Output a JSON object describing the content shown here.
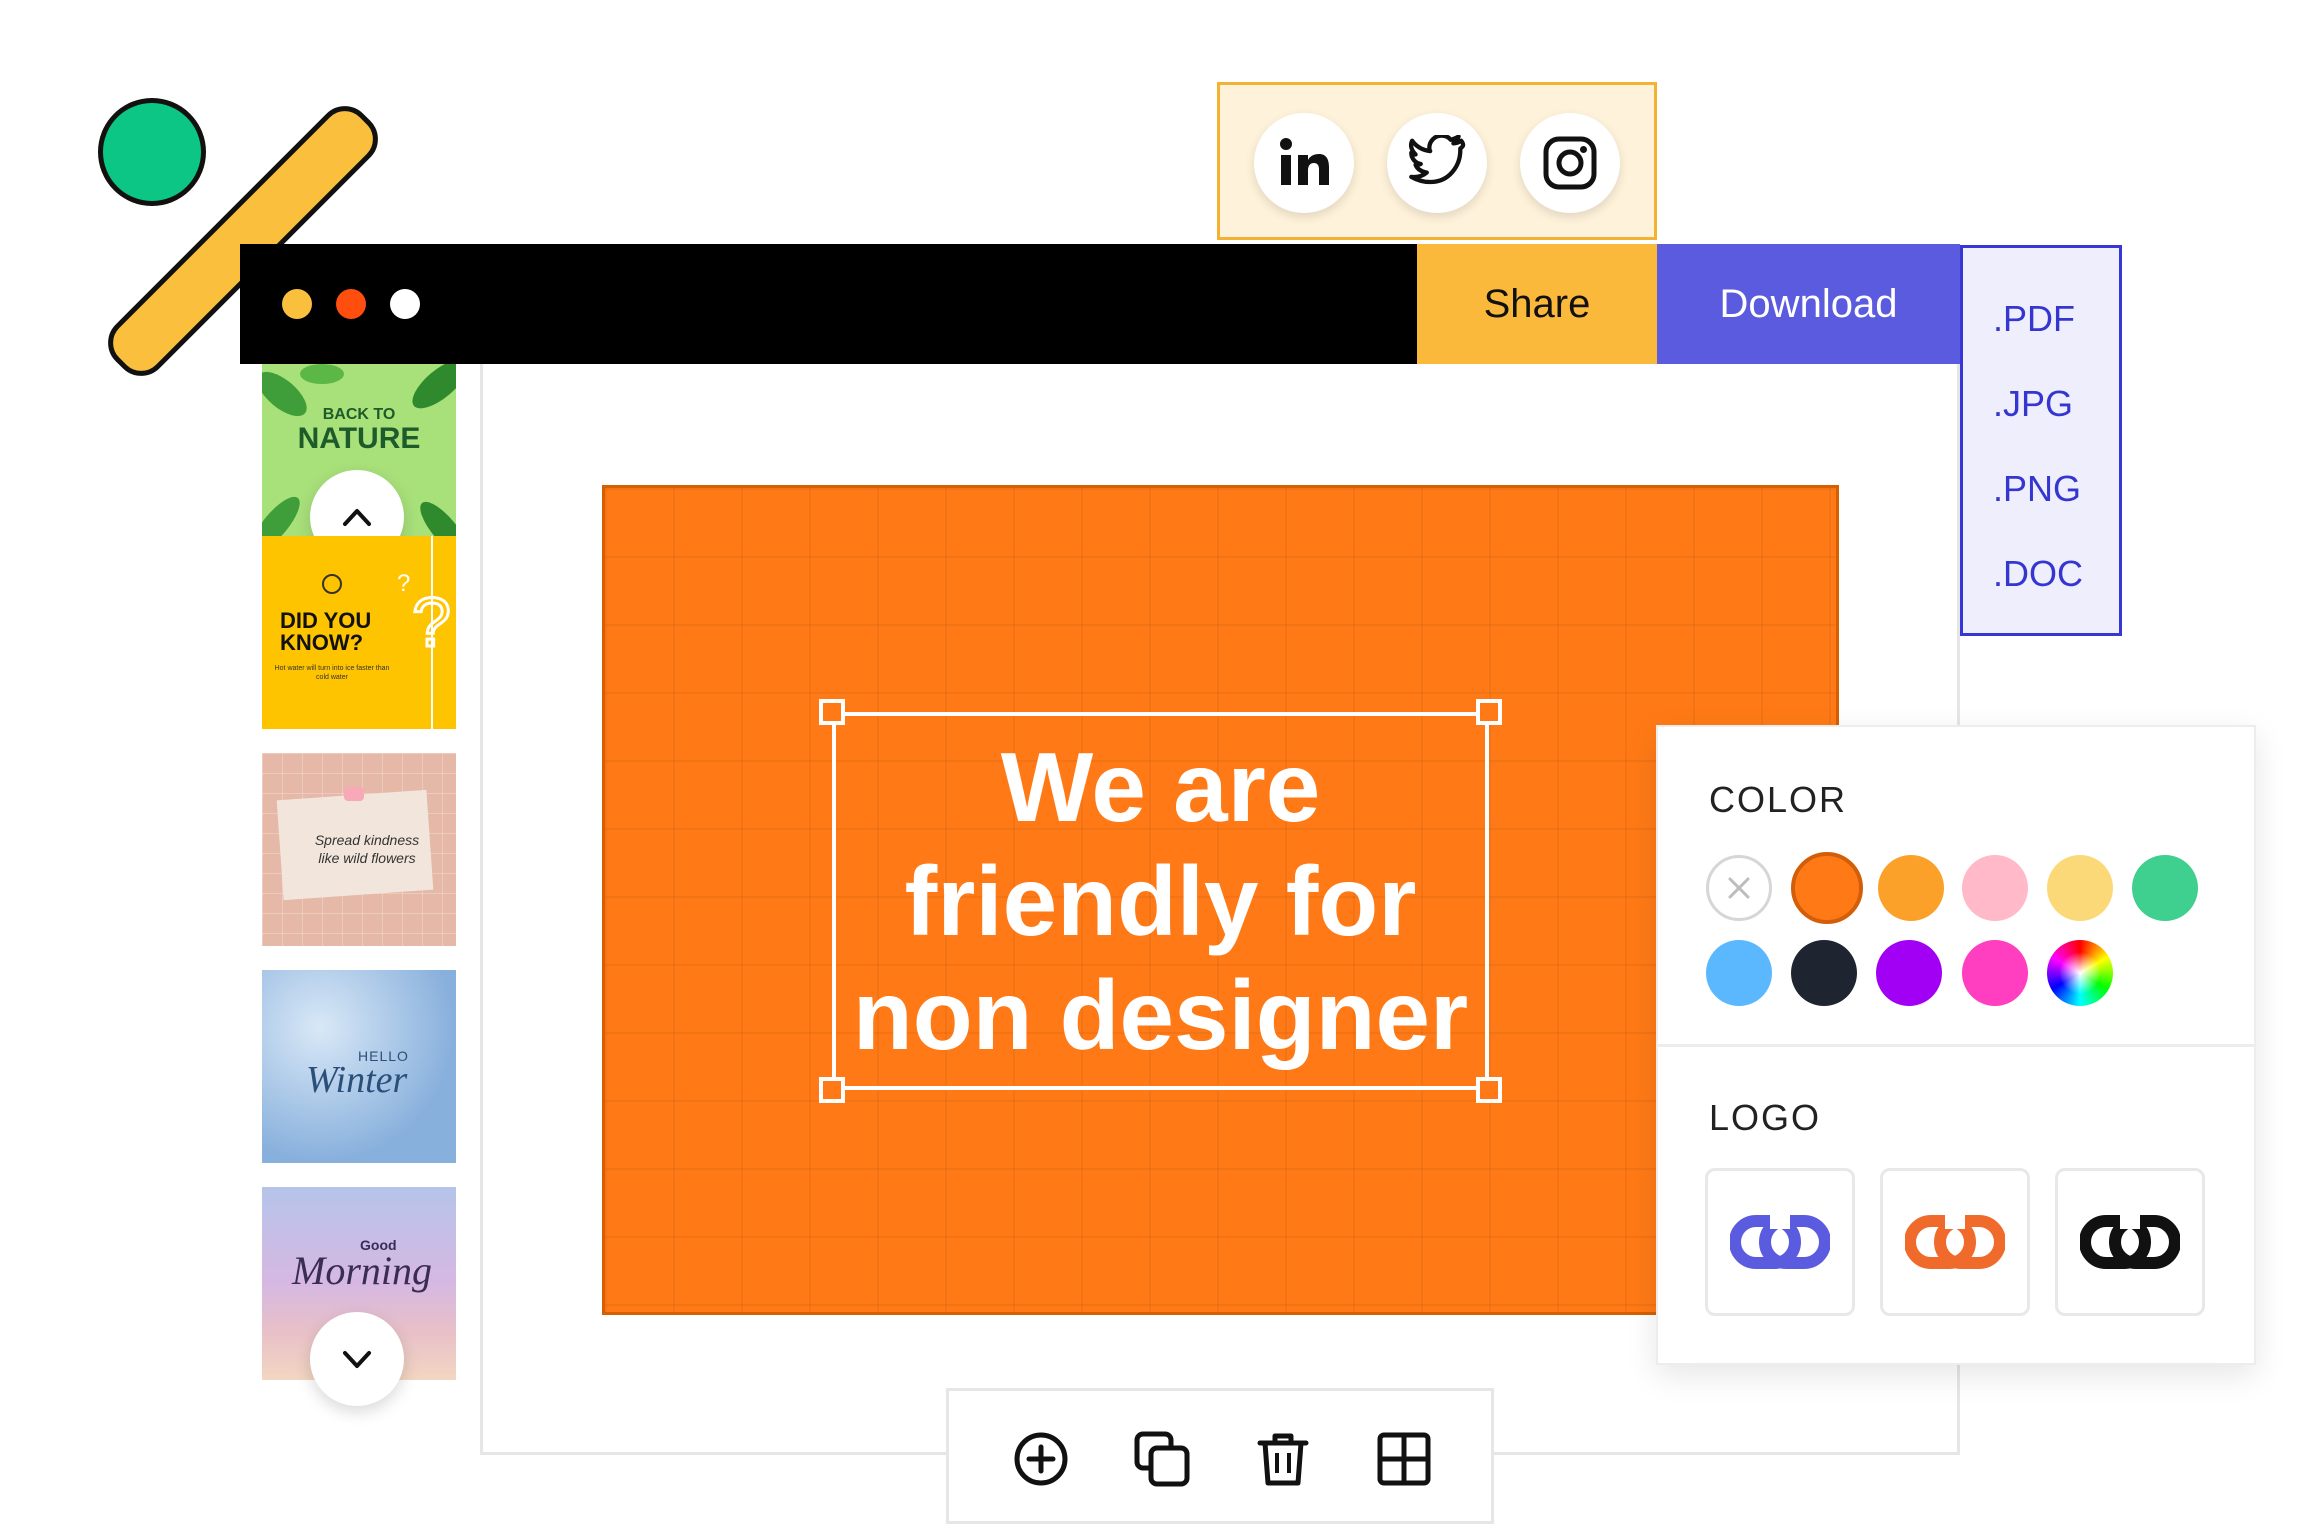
{
  "toolbar": {
    "share_label": "Share",
    "download_label": "Download"
  },
  "window_dots": [
    "#FBBF3E",
    "#FF4E0E",
    "#FFFFFF"
  ],
  "social": [
    "linkedin-icon",
    "twitter-icon",
    "instagram-icon"
  ],
  "export_formats": [
    ".PDF",
    ".JPG",
    ".PNG",
    ".DOC"
  ],
  "templates": [
    {
      "lines": [
        "BACK TO",
        "NATURE"
      ],
      "bg": "#A8E07A"
    },
    {
      "lines": [
        "DID YOU",
        "KNOW?"
      ],
      "small": "Hot water will turn into ice faster than cold water",
      "bg": "#FFC400"
    },
    {
      "lines": [
        "Spread kindness",
        "like wild flowers"
      ],
      "bg": "#E6B8A8"
    },
    {
      "lines": [
        "HELLO",
        "Winter"
      ],
      "bg": "#A9C8E8"
    },
    {
      "lines": [
        "Good",
        "Morning"
      ],
      "bg": "#C9B8E8"
    }
  ],
  "canvas": {
    "headline_lines": [
      "We are",
      "friendly for",
      "non designer"
    ],
    "bg": "#FF7A16"
  },
  "panel": {
    "color_title": "COLOR",
    "logo_title": "LOGO",
    "colors_row1": [
      "none",
      "#FF7A16",
      "#FBA12A",
      "#FFB9C8",
      "#FCD978",
      "#3FCF8E"
    ],
    "colors_row2": [
      "#5BB8FF",
      "#1E2530",
      "#A100F5",
      "#FF3FBF",
      "rainbow"
    ],
    "selected_color": "#FF7A16",
    "logos": [
      "#5B5BE0",
      "#F06A2B",
      "#111111"
    ]
  },
  "bottom_tools": [
    "add-icon",
    "duplicate-icon",
    "delete-icon",
    "grid-icon"
  ]
}
